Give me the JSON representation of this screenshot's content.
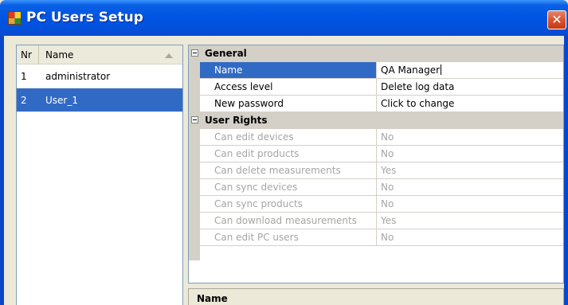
{
  "window": {
    "title": "PC Users Setup",
    "close_glyph": "✕"
  },
  "user_list": {
    "columns": {
      "nr": "Nr",
      "name": "Name"
    },
    "rows": [
      {
        "nr": "1",
        "name": "administrator",
        "selected": false
      },
      {
        "nr": "2",
        "name": "User_1",
        "selected": true
      }
    ]
  },
  "property_grid": {
    "categories": [
      {
        "label": "General",
        "properties": [
          {
            "name": "Name",
            "value": "QA Manager",
            "selected": true,
            "enabled": true
          },
          {
            "name": "Access level",
            "value": "Delete log data",
            "selected": false,
            "enabled": true
          },
          {
            "name": "New password",
            "value": "Click to change",
            "selected": false,
            "enabled": true
          }
        ]
      },
      {
        "label": "User Rights",
        "properties": [
          {
            "name": "Can edit devices",
            "value": "No",
            "enabled": false
          },
          {
            "name": "Can edit products",
            "value": "No",
            "enabled": false
          },
          {
            "name": "Can delete measurements",
            "value": "Yes",
            "enabled": false
          },
          {
            "name": "Can sync devices",
            "value": "No",
            "enabled": false
          },
          {
            "name": "Can sync products",
            "value": "No",
            "enabled": false
          },
          {
            "name": "Can download measurements",
            "value": "Yes",
            "enabled": false
          },
          {
            "name": "Can edit PC users",
            "value": "No",
            "enabled": false
          }
        ]
      }
    ]
  },
  "description": {
    "title": "Name"
  },
  "colors": {
    "selection": "#316AC5",
    "title_bar": "#0054E3",
    "disabled_text": "#A5A5A5"
  }
}
